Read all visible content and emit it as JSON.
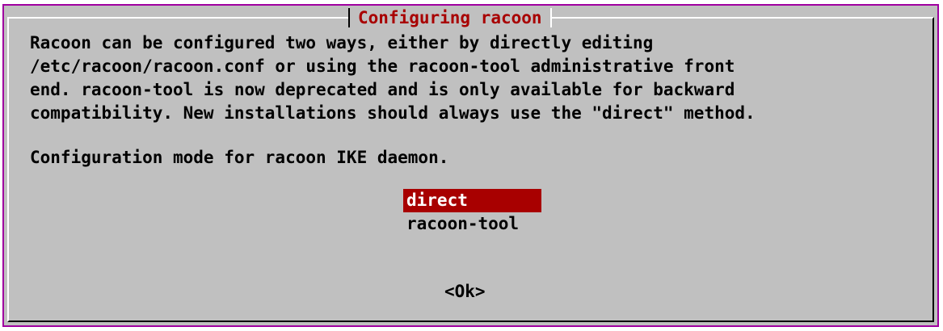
{
  "dialog": {
    "title": "Configuring racoon",
    "description_lines": [
      "Racoon can be configured two ways, either by directly editing",
      "/etc/racoon/racoon.conf or using the racoon-tool administrative front",
      "end. racoon-tool is now deprecated and is only available for backward",
      "compatibility. New installations should always use the \"direct\" method."
    ],
    "prompt": "Configuration mode for racoon IKE daemon.",
    "options": [
      {
        "label": "direct",
        "selected": true
      },
      {
        "label": "racoon-tool",
        "selected": false
      }
    ],
    "ok_label": "<Ok>"
  },
  "colors": {
    "border": "#a000a0",
    "dialog_bg": "#c0c0c0",
    "accent": "#a80000",
    "text": "#000000"
  }
}
